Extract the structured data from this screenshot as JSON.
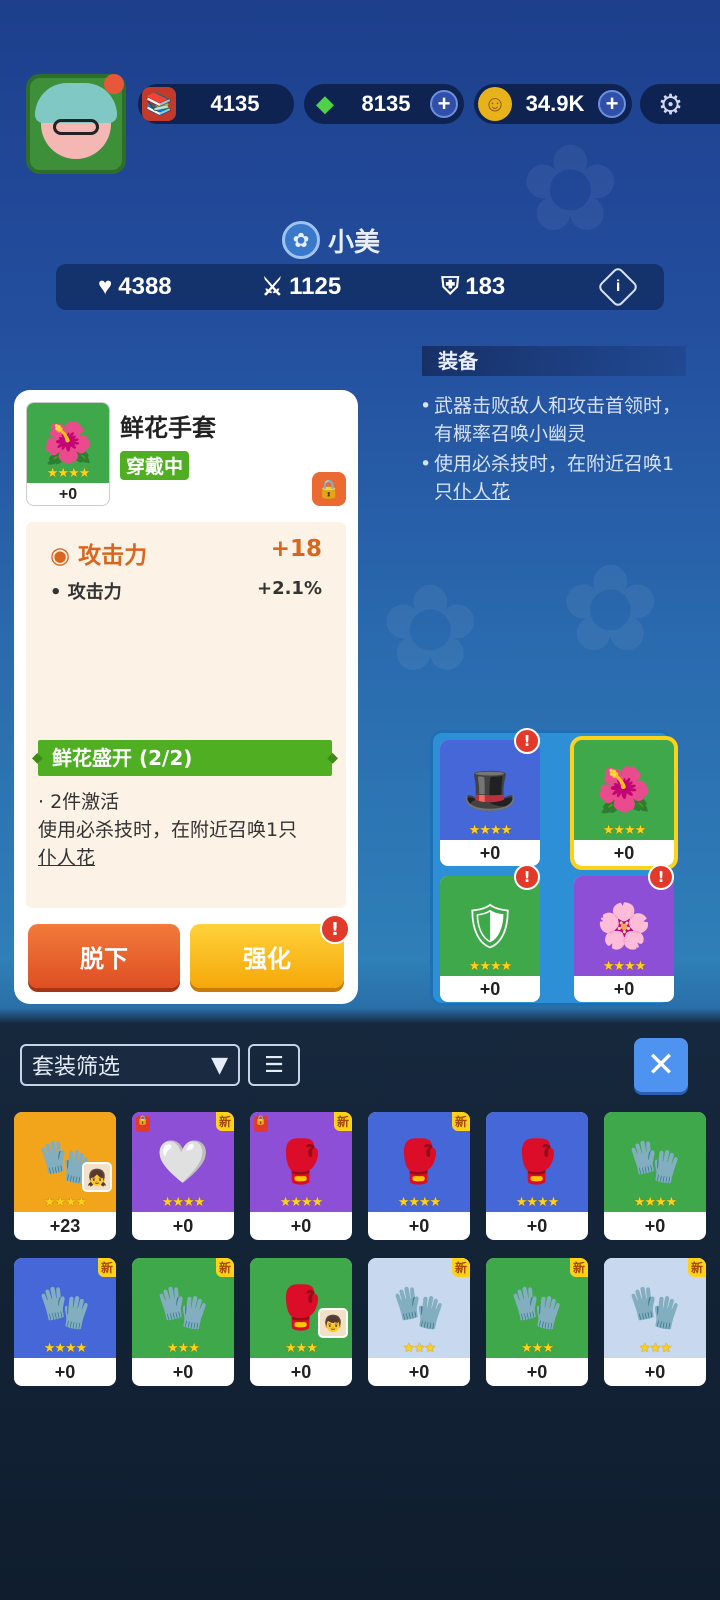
{
  "resources": {
    "books": "4135",
    "gems": "8135",
    "coins": "34.9K"
  },
  "profile": {
    "name": "小美",
    "hp": "4388",
    "attack": "1125",
    "defense": "183"
  },
  "equip_info": {
    "title": "装备",
    "line1": "武器击败敌人和攻击首领时，有概率召唤小幽灵",
    "line2_prefix": "使用必杀技时，在附近召唤1只",
    "line2_link": "仆人花"
  },
  "item": {
    "name": "鲜花手套",
    "status": "穿戴中",
    "level": "+0",
    "main_stat_label": "攻击力",
    "main_stat_value": "+18",
    "sub_stat_label": "攻击力",
    "sub_stat_value": "+2.1%",
    "set_name": "鲜花盛开 (2/2)",
    "set_pieces": "2件激活",
    "set_desc_prefix": "使用必杀技时，在附近召唤1只",
    "set_desc_link": "仆人花"
  },
  "buttons": {
    "unequip": "脱下",
    "enhance": "强化",
    "alert": "!"
  },
  "equipped_slots": [
    {
      "icon": "wizard-hat-icon",
      "level": "+0",
      "alert": "!"
    },
    {
      "icon": "flower-glove-icon",
      "level": "+0"
    },
    {
      "icon": "armor-icon",
      "level": "+0",
      "alert": "!"
    },
    {
      "icon": "flower-boots-icon",
      "level": "+0",
      "alert": "!"
    }
  ],
  "filter": {
    "label": "套装筛选"
  },
  "inventory": [
    {
      "icon": "yellow-glove-icon",
      "level": "+23"
    },
    {
      "icon": "white-glove-icon",
      "level": "+0",
      "tag": "新"
    },
    {
      "icon": "spiked-glove-icon",
      "level": "+0",
      "tag": "新"
    },
    {
      "icon": "red-glove-icon",
      "level": "+0",
      "tag": "新"
    },
    {
      "icon": "red-glove-icon",
      "level": "+0"
    },
    {
      "icon": "yellow-glove-icon",
      "level": "+0"
    },
    {
      "icon": "dark-green-glove-icon",
      "level": "+0",
      "tag": "新"
    },
    {
      "icon": "golden-glove-icon",
      "level": "+0",
      "tag": "新"
    },
    {
      "icon": "red-glove-icon",
      "level": "+0",
      "tag": "新"
    },
    {
      "icon": "ice-glove-icon",
      "level": "+0",
      "tag": "新"
    },
    {
      "icon": "yellow-glove-icon",
      "level": "+0",
      "tag": "新"
    },
    {
      "icon": "dark-green-glove-icon",
      "level": "+0",
      "tag": "新"
    }
  ],
  "colors": {
    "accent_green": "#4fae22",
    "stat_orange": "#d8661e",
    "alert_red": "#e23a2a"
  }
}
